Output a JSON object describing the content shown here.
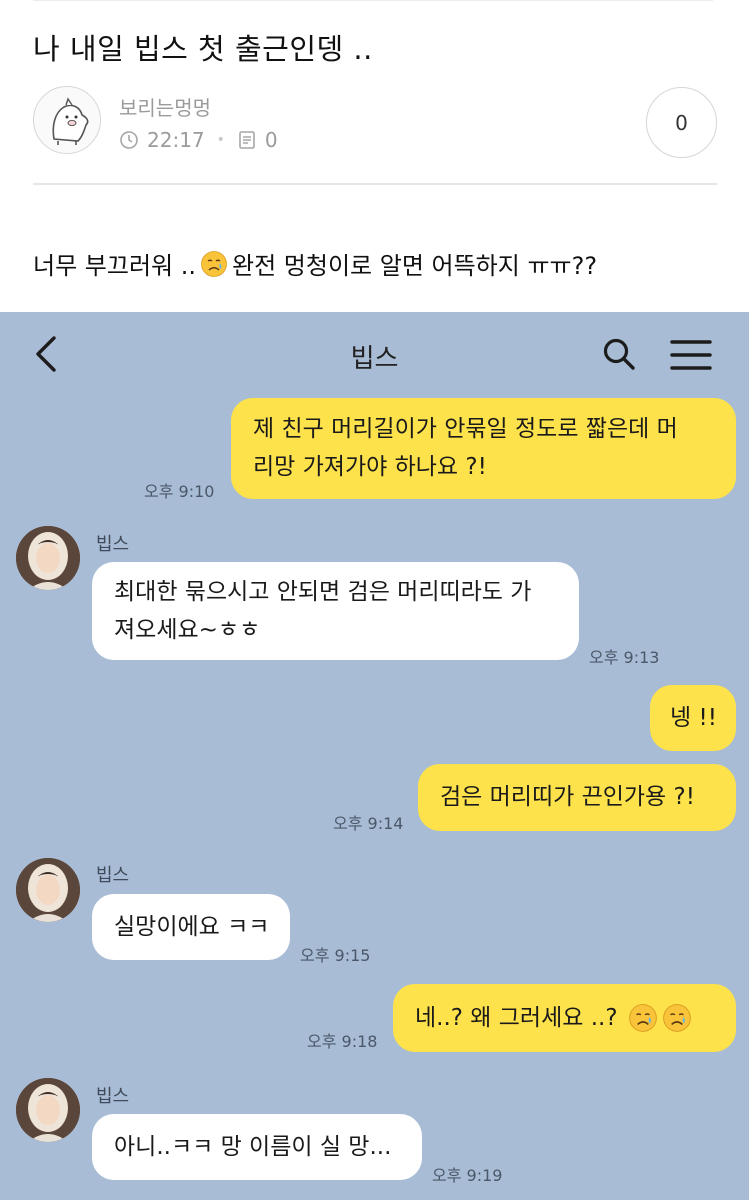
{
  "post": {
    "title": "나 내일 빕스 첫 출근인뎅 ..",
    "author": "보리는멍멍",
    "time": "22:17",
    "comment_count": "0",
    "like_count": "0",
    "body_before": "너무 부끄러워 ..",
    "body_after": "완전 멍청이로 알면 어뜩하지 ㅠㅠ??"
  },
  "chat": {
    "title": "빕스",
    "messages": [
      {
        "from": "me",
        "line1": "제 친구 머리길이가 안묶일 정도로 짧은데 머",
        "line2": "리망 가져가야 하나요 ?!",
        "time": "오후 9:10"
      },
      {
        "from": "them",
        "sender": "빕스",
        "line1": "최대한 묶으시고 안되면 검은 머리띠라도 가",
        "line2": "져오세요~ㅎㅎ",
        "time": "오후 9:13"
      },
      {
        "from": "me",
        "text": "넹 !!"
      },
      {
        "from": "me",
        "text": "검은 머리띠가 끈인가용 ?!",
        "time": "오후 9:14"
      },
      {
        "from": "them",
        "sender": "빕스",
        "text": "실망이에요 ㅋㅋ",
        "time": "오후 9:15"
      },
      {
        "from": "me",
        "text": "네..? 왜 그러세요 ..?",
        "time": "오후 9:18"
      },
      {
        "from": "them",
        "sender": "빕스",
        "text": "아니..ㅋㅋ 망 이름이 실 망...",
        "time": "오후 9:19"
      }
    ]
  },
  "icons": {
    "emoji": "crying-face",
    "back": "chevron-left-icon",
    "search": "search-icon",
    "menu": "hamburger-menu-icon"
  },
  "colors": {
    "chat_bg": "#a8bcd5",
    "my_bubble": "#fde24b",
    "their_bubble": "#ffffff"
  }
}
